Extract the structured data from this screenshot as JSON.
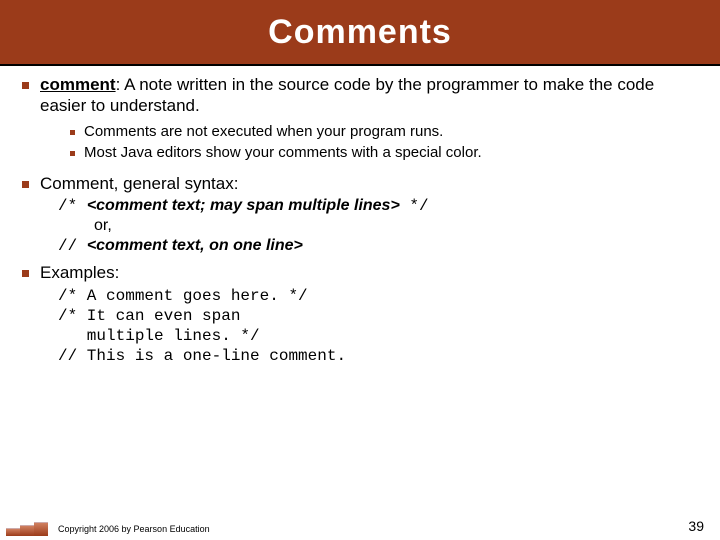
{
  "title": "Comments",
  "bullets": {
    "definition": {
      "term": "comment",
      "text": ": A note written in the source code by the programmer to make the code easier to understand.",
      "sub": [
        "Comments are not executed when your program runs.",
        "Most Java editors show your comments with a special color."
      ]
    },
    "syntax": {
      "label": "Comment, general syntax:",
      "open1": "/* ",
      "body1": "<comment text; may span multiple lines>",
      "close1": " */",
      "or": "or,",
      "open2": "// ",
      "body2": "<comment text, on one line>"
    },
    "examples": {
      "label": "Examples:",
      "lines": "/* A comment goes here. */\n/* It can even span\n   multiple lines. */\n// This is a one-line comment."
    }
  },
  "footer": {
    "copyright": "Copyright 2006 by Pearson Education",
    "page": "39"
  }
}
